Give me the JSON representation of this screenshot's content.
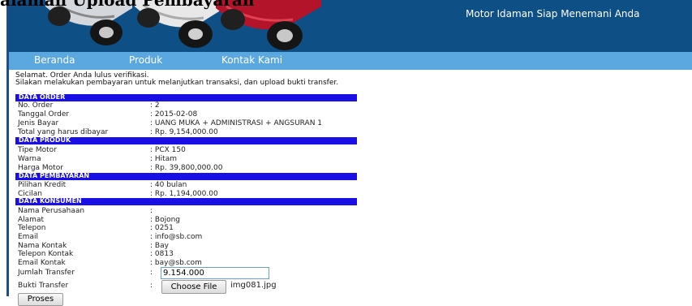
{
  "header": {
    "title": "alaman Upload Pembayaran",
    "tagline": "Motor Idaman Siap Menemani Anda"
  },
  "nav": {
    "items": [
      "Beranda",
      "Produk",
      "Kontak Kami"
    ]
  },
  "messages": [
    "Selamat. Order Anda lulus verifikasi.",
    "Silakan melakukan pembayaran untuk melanjutkan transaksi, dan upload bukti transfer."
  ],
  "sections": {
    "order": "DATA ORDER",
    "produk": "DATA PRODUK",
    "pembayaran": "DATA PEMBAYARAN",
    "konsumen": "DATA KONSUMEN"
  },
  "order": {
    "no_order": {
      "label": "No. Order",
      "value": ": 2"
    },
    "tanggal": {
      "label": "Tanggal Order",
      "value": ": 2015-02-08"
    },
    "jenis_bayar": {
      "label": "Jenis Bayar",
      "value": ": UANG MUKA + ADMINISTRASI + ANGSURAN 1"
    },
    "total": {
      "label": "Total yang harus dibayar",
      "value": ": Rp. 9,154,000.00"
    }
  },
  "produk": {
    "tipe": {
      "label": "Tipe Motor",
      "value": ": PCX 150"
    },
    "warna": {
      "label": "Warna",
      "value": ": Hitam"
    },
    "harga": {
      "label": "Harga Motor",
      "value": ": Rp. 39,800,000.00"
    }
  },
  "pembayaran": {
    "kredit": {
      "label": "Pilihan Kredit",
      "value": ": 40 bulan"
    },
    "cicilan": {
      "label": "Cicilan",
      "value": ": Rp. 1,194,000.00"
    }
  },
  "konsumen": {
    "perusahaan": {
      "label": "Nama Perusahaan",
      "value": ":"
    },
    "alamat": {
      "label": "Alamat",
      "value": ": Bojong"
    },
    "telepon": {
      "label": "Telepon",
      "value": ": 0251"
    },
    "email": {
      "label": "Email",
      "value": ": info@sb.com"
    },
    "nama_kontak": {
      "label": "Nama Kontak",
      "value": ": Bay"
    },
    "telepon_kontak": {
      "label": "Telepon Kontak",
      "value": ": 0813"
    },
    "email_kontak": {
      "label": "Email Kontak",
      "value": ": bay@sb.com"
    }
  },
  "form": {
    "jumlah_label": "Jumlah Transfer",
    "jumlah_colon": ":",
    "jumlah_value": "9.154.000",
    "bukti_label": "Bukti Transfer",
    "bukti_colon": ":",
    "choose_file": "Choose File",
    "file_name": "img081.jpg",
    "submit": "Proses"
  },
  "colors": {
    "banner": "#0e4f86",
    "nav": "#5ba7e0",
    "section_header": "#1a10e6"
  }
}
